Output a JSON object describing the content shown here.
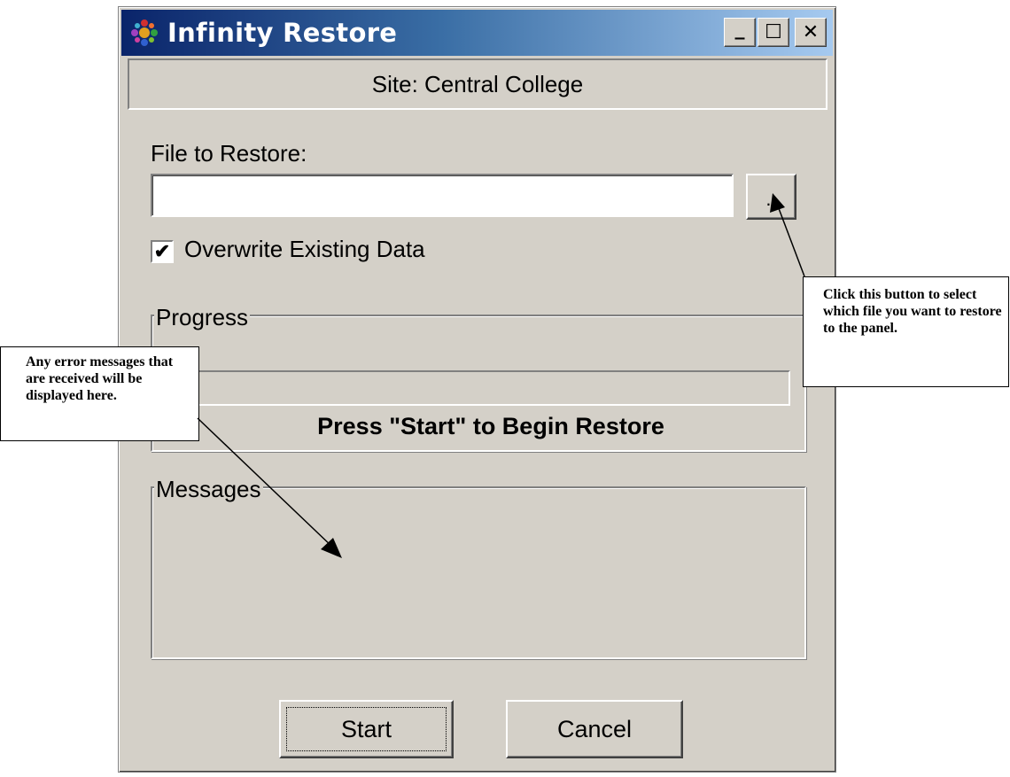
{
  "window": {
    "title": "Infinity Restore",
    "minimize_label": "_",
    "maximize_label": "☐",
    "close_label": "✕"
  },
  "site": {
    "text": "Site: Central College"
  },
  "file": {
    "label": "File to Restore:",
    "value": "",
    "browse_label": ".."
  },
  "overwrite": {
    "label": "Overwrite Existing Data",
    "checked": true,
    "check_mark": "✔"
  },
  "progress": {
    "group_label": "Progress",
    "status": "Press \"Start\" to Begin Restore",
    "fraction": 0
  },
  "messages": {
    "group_label": "Messages"
  },
  "buttons": {
    "start": "Start",
    "cancel": "Cancel"
  },
  "callouts": {
    "browse": "Click this button to select which file you want to restore to the panel.",
    "errors": "Any error messages that are received will be displayed here."
  }
}
